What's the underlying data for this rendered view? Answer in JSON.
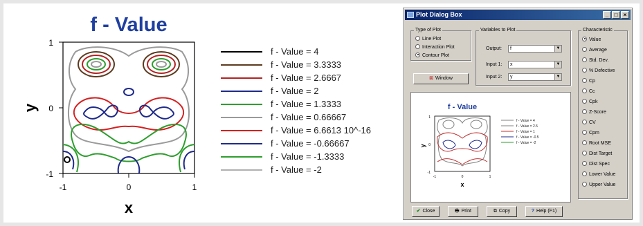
{
  "main_plot": {
    "title": "f - Value",
    "xlabel": "x",
    "ylabel": "y",
    "x_ticks": [
      "-1",
      "0",
      "1"
    ],
    "y_ticks": [
      "1",
      "0",
      "-1"
    ],
    "legend": [
      {
        "label": "f - Value = 4",
        "color": "#000000"
      },
      {
        "label": "f - Value = 3.3333",
        "color": "#5c3a1e"
      },
      {
        "label": "f - Value = 2.6667",
        "color": "#b22222"
      },
      {
        "label": "f - Value = 2",
        "color": "#1e2a8a"
      },
      {
        "label": "f - Value = 1.3333",
        "color": "#2e9e2e"
      },
      {
        "label": "f - Value = 0.66667",
        "color": "#9a9a9a"
      },
      {
        "label": "f - Value = 6.6613 10^-16",
        "color": "#d42020"
      },
      {
        "label": "f - Value = -0.66667",
        "color": "#1e2a8a"
      },
      {
        "label": "f - Value = -1.3333",
        "color": "#2e9e2e"
      },
      {
        "label": "f - Value = -2",
        "color": "#b0b0b0"
      }
    ]
  },
  "dialog": {
    "title": "Plot Dialog Box",
    "type_of_plot": {
      "title": "Type of Plot",
      "options": [
        {
          "label": "Line Plot",
          "selected": false
        },
        {
          "label": "Interaction Plot",
          "selected": false
        },
        {
          "label": "Contour Plot",
          "selected": true
        }
      ]
    },
    "window_button": "Window",
    "variables": {
      "title": "Variables to Plot",
      "output_label": "Output:",
      "output_value": "f",
      "input1_label": "Input 1:",
      "input1_value": "x",
      "input2_label": "Input 2:",
      "input2_value": "y"
    },
    "characteristic": {
      "title": "Characteristic",
      "options": [
        {
          "label": "Value",
          "selected": true
        },
        {
          "label": "Average",
          "selected": false
        },
        {
          "label": "Std. Dev.",
          "selected": false
        },
        {
          "label": "% Defective",
          "selected": false
        },
        {
          "label": "Cp",
          "selected": false
        },
        {
          "label": "Cc",
          "selected": false
        },
        {
          "label": "Cpk",
          "selected": false
        },
        {
          "label": "Z-Score",
          "selected": false
        },
        {
          "label": "CV",
          "selected": false
        },
        {
          "label": "Cpm",
          "selected": false
        },
        {
          "label": "Root MSE",
          "selected": false
        },
        {
          "label": "Dist Target",
          "selected": false
        },
        {
          "label": "Dist Spec",
          "selected": false
        },
        {
          "label": "Lower Value",
          "selected": false
        },
        {
          "label": "Upper Value",
          "selected": false
        }
      ]
    },
    "mini_plot": {
      "title": "f - Value",
      "xlabel": "x",
      "ylabel": "y",
      "x_ticks": [
        "-1",
        "0",
        "1"
      ],
      "y_ticks": [
        "1",
        "0",
        "-1"
      ],
      "legend": [
        {
          "label": "f - Value = 4",
          "color": "#808080"
        },
        {
          "label": "f - Value = 2.5",
          "color": "#808080"
        },
        {
          "label": "f - Value = 1",
          "color": "#c03030"
        },
        {
          "label": "f - Value = -0.5",
          "color": "#1e2a8a"
        },
        {
          "label": "f - Value = -2",
          "color": "#2e9e2e"
        }
      ]
    },
    "buttons": {
      "close": "Close",
      "print": "Print",
      "copy": "Copy",
      "help": "Help (F1)"
    }
  },
  "colors": {
    "title_blue": "#1f3fa0",
    "titlebar_blue": "#0a246a",
    "dialog_gray": "#d4d0c8"
  }
}
